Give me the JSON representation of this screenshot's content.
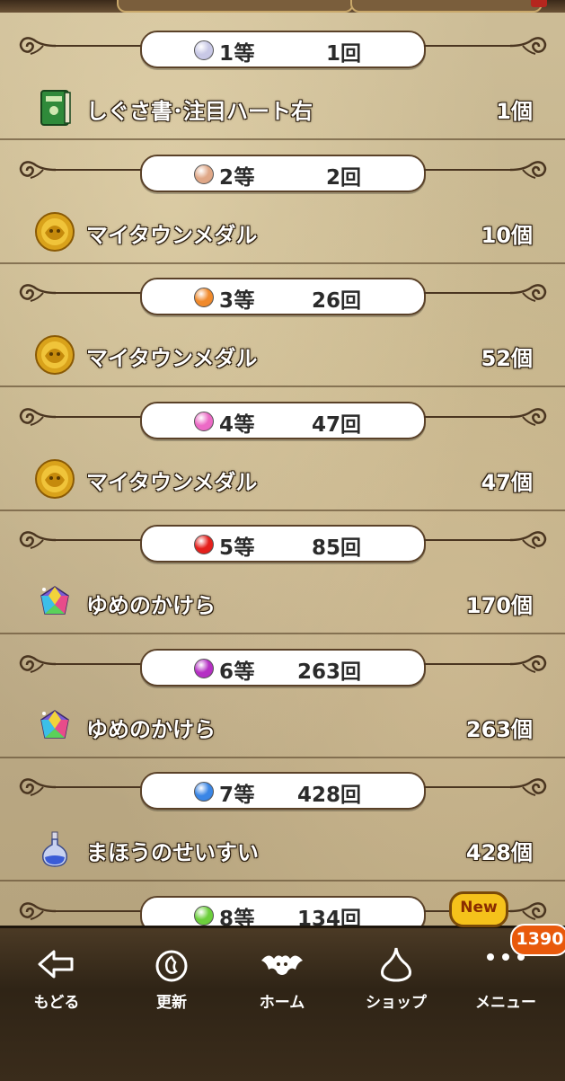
{
  "sections": [
    {
      "rank": "1等",
      "count": "1回",
      "orb_color": "#c8c8e6",
      "item": "しぐさ書･注目ハート右",
      "qty": "1個",
      "icon": "green-book-icon"
    },
    {
      "rank": "2等",
      "count": "2回",
      "orb_color": "#e0a888",
      "item": "マイタウンメダル",
      "qty": "10個",
      "icon": "gold-medal-icon"
    },
    {
      "rank": "3等",
      "count": "26回",
      "orb_color": "#f08a2c",
      "item": "マイタウンメダル",
      "qty": "52個",
      "icon": "gold-medal-icon"
    },
    {
      "rank": "4等",
      "count": "47回",
      "orb_color": "#ec6ac6",
      "item": "マイタウンメダル",
      "qty": "47個",
      "icon": "gold-medal-icon"
    },
    {
      "rank": "5等",
      "count": "85回",
      "orb_color": "#e5201c",
      "item": "ゆめのかけら",
      "qty": "170個",
      "icon": "rainbow-gem-icon"
    },
    {
      "rank": "6等",
      "count": "263回",
      "orb_color": "#b52fc4",
      "item": "ゆめのかけら",
      "qty": "263個",
      "icon": "rainbow-gem-icon"
    },
    {
      "rank": "7等",
      "count": "428回",
      "orb_color": "#3a86e6",
      "item": "まほうのせいすい",
      "qty": "428個",
      "icon": "holy-water-icon"
    },
    {
      "rank": "8等",
      "count": "134回",
      "orb_color": "#6ccf3c",
      "item": "",
      "qty": "",
      "icon": ""
    }
  ],
  "nav": {
    "back": "もどる",
    "refresh": "更新",
    "home": "ホーム",
    "shop": "ショップ",
    "menu": "メニュー",
    "new_badge": "New",
    "count_badge": "1390"
  }
}
